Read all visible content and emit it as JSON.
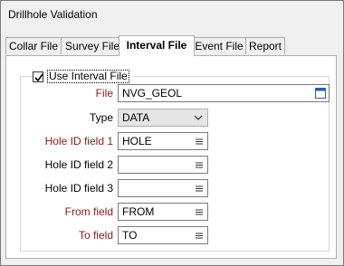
{
  "window": {
    "title": "Drillhole Validation"
  },
  "tabs": [
    {
      "label": "Collar File"
    },
    {
      "label": "Survey File"
    },
    {
      "label": "Interval File"
    },
    {
      "label": "Event File"
    },
    {
      "label": "Report"
    }
  ],
  "group": {
    "checkbox_label": "Use Interval File",
    "checked": true
  },
  "fields": {
    "file": {
      "label": "File",
      "value": "NVG_GEOL",
      "required": true
    },
    "type": {
      "label": "Type",
      "value": "DATA",
      "required": false
    },
    "hole_id_1": {
      "label": "Hole ID field 1",
      "value": "HOLE",
      "required": true
    },
    "hole_id_2": {
      "label": "Hole ID field 2",
      "value": "",
      "required": false
    },
    "hole_id_3": {
      "label": "Hole ID field 3",
      "value": "",
      "required": false
    },
    "from": {
      "label": "From field",
      "value": "FROM",
      "required": true
    },
    "to": {
      "label": "To field",
      "value": "TO",
      "required": true
    }
  },
  "colors": {
    "required_label": "#8b1a1a",
    "active_tab_bg": "#ffffff"
  },
  "icons": {
    "file_browse": "window-icon",
    "field_list": "list-icon",
    "dropdown": "chevron-down-icon"
  }
}
